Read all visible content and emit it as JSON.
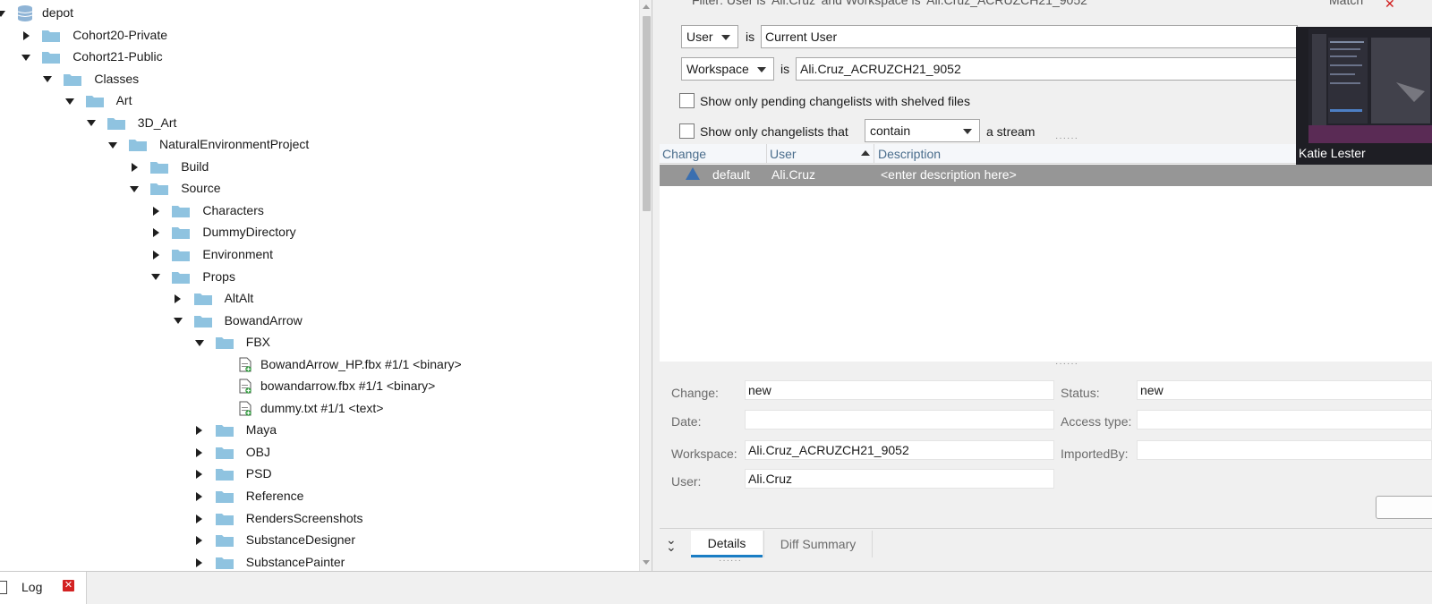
{
  "tree": {
    "nodes": [
      {
        "label": "depot",
        "depth": 0,
        "icon": "database-icon",
        "expand": "down"
      },
      {
        "label": "Cohort20-Private",
        "depth": 1,
        "icon": "folder-icon",
        "expand": "right"
      },
      {
        "label": "Cohort21-Public",
        "depth": 1,
        "icon": "folder-icon",
        "expand": "down"
      },
      {
        "label": "Classes",
        "depth": 2,
        "icon": "folder-icon",
        "expand": "down"
      },
      {
        "label": "Art",
        "depth": 3,
        "icon": "folder-icon",
        "expand": "down"
      },
      {
        "label": "3D_Art",
        "depth": 4,
        "icon": "folder-icon",
        "expand": "down"
      },
      {
        "label": "NaturalEnvironmentProject",
        "depth": 5,
        "icon": "folder-icon",
        "expand": "down"
      },
      {
        "label": "Build",
        "depth": 6,
        "icon": "folder-icon",
        "expand": "right"
      },
      {
        "label": "Source",
        "depth": 6,
        "icon": "folder-icon",
        "expand": "down"
      },
      {
        "label": "Characters",
        "depth": 7,
        "icon": "folder-icon",
        "expand": "right"
      },
      {
        "label": "DummyDirectory",
        "depth": 7,
        "icon": "folder-icon",
        "expand": "right"
      },
      {
        "label": "Environment",
        "depth": 7,
        "icon": "folder-icon",
        "expand": "right"
      },
      {
        "label": "Props",
        "depth": 7,
        "icon": "folder-icon",
        "expand": "down"
      },
      {
        "label": "AltAlt",
        "depth": 8,
        "icon": "folder-icon",
        "expand": "right"
      },
      {
        "label": "BowandArrow",
        "depth": 8,
        "icon": "folder-icon",
        "expand": "down"
      },
      {
        "label": "FBX",
        "depth": 9,
        "icon": "folder-icon",
        "expand": "down"
      },
      {
        "label": "BowandArrow_HP.fbx #1/1 <binary>",
        "depth": 10,
        "icon": "file-add-icon",
        "expand": "none"
      },
      {
        "label": "bowandarrow.fbx #1/1 <binary>",
        "depth": 10,
        "icon": "file-add-icon",
        "expand": "none"
      },
      {
        "label": "dummy.txt #1/1 <text>",
        "depth": 10,
        "icon": "file-add-icon",
        "expand": "none"
      },
      {
        "label": "Maya",
        "depth": 9,
        "icon": "folder-icon",
        "expand": "right"
      },
      {
        "label": "OBJ",
        "depth": 9,
        "icon": "folder-icon",
        "expand": "right"
      },
      {
        "label": "PSD",
        "depth": 9,
        "icon": "folder-icon",
        "expand": "right"
      },
      {
        "label": "Reference",
        "depth": 9,
        "icon": "folder-icon",
        "expand": "right"
      },
      {
        "label": "RendersScreenshots",
        "depth": 9,
        "icon": "folder-icon",
        "expand": "right"
      },
      {
        "label": "SubstanceDesigner",
        "depth": 9,
        "icon": "folder-icon",
        "expand": "right"
      },
      {
        "label": "SubstancePainter",
        "depth": 9,
        "icon": "folder-icon",
        "expand": "right"
      }
    ]
  },
  "filters": {
    "summary": "Filter: User is 'Ali.Cruz' and Workspace is 'Ali.Cruz_ACRUZCH21_9052'",
    "match_label": "Match",
    "user_combo": "User",
    "is_label": "is",
    "user_value": "Current User",
    "workspace_combo": "Workspace",
    "workspace_value": "Ali.Cruz_ACRUZCH21_9052",
    "shelved_checkbox_label": "Show only pending changelists with shelved files",
    "stream_checkbox_label": "Show only changelists that",
    "stream_combo": "contain",
    "stream_suffix": "a stream"
  },
  "changelists": {
    "columns": [
      "Change",
      "User",
      "Description"
    ],
    "rows": [
      {
        "change": "default",
        "user": "Ali.Cruz",
        "description": "<enter description here>"
      }
    ]
  },
  "details": {
    "change_label": "Change:",
    "change_value": "new",
    "date_label": "Date:",
    "date_value": "",
    "workspace_label": "Workspace:",
    "workspace_value": "Ali.Cruz_ACRUZCH21_9052",
    "user_label": "User:",
    "user_value": "Ali.Cruz",
    "status_label": "Status:",
    "status_value": "new",
    "access_type_label": "Access type:",
    "access_type_value": "",
    "imported_by_label": "ImportedBy:",
    "imported_by_value": ""
  },
  "tabs": [
    {
      "label": "Details"
    },
    {
      "label": "Diff Summary"
    }
  ],
  "video": {
    "participant_name": "Katie Lester"
  },
  "bottom_bar": {
    "log_label": "Log"
  },
  "colors": {
    "folder": "#8fc3e0",
    "selected_row": "#969696",
    "accent_tab": "#1a7dc4",
    "header_text": "#4a6d8c"
  }
}
